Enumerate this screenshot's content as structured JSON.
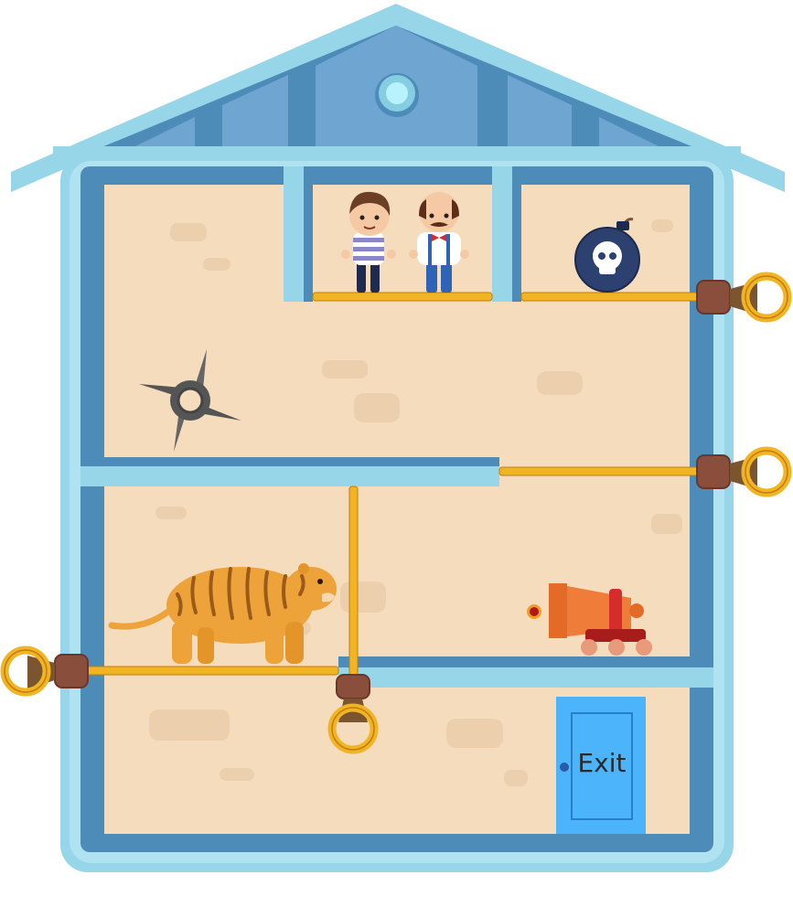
{
  "game": {
    "exit_label": "Exit",
    "pins": [
      "top-right-pin",
      "middle-right-pin",
      "left-pin",
      "vertical-pin"
    ],
    "characters": [
      "boy",
      "old-man"
    ],
    "hazards": [
      "bomb",
      "shuriken",
      "tiger",
      "cannon"
    ]
  },
  "colors": {
    "house_outer": "#97d6e9",
    "house_wall": "#4d8cb8",
    "floor_fill": "#f5dcbd",
    "brick": "#ecd0ae",
    "pin_gold": "#f1b423",
    "exit_door": "#4bb4fb",
    "tiger_orange": "#eda33a",
    "cannon_orange": "#f07c3a",
    "bomb": "#2d4171"
  },
  "icons": {
    "bomb": "skull-bomb-icon",
    "shuriken": "shuriken-icon",
    "cannon": "cannon-icon",
    "tiger": "tiger-icon",
    "pin_ring": "pin-ring-icon"
  }
}
